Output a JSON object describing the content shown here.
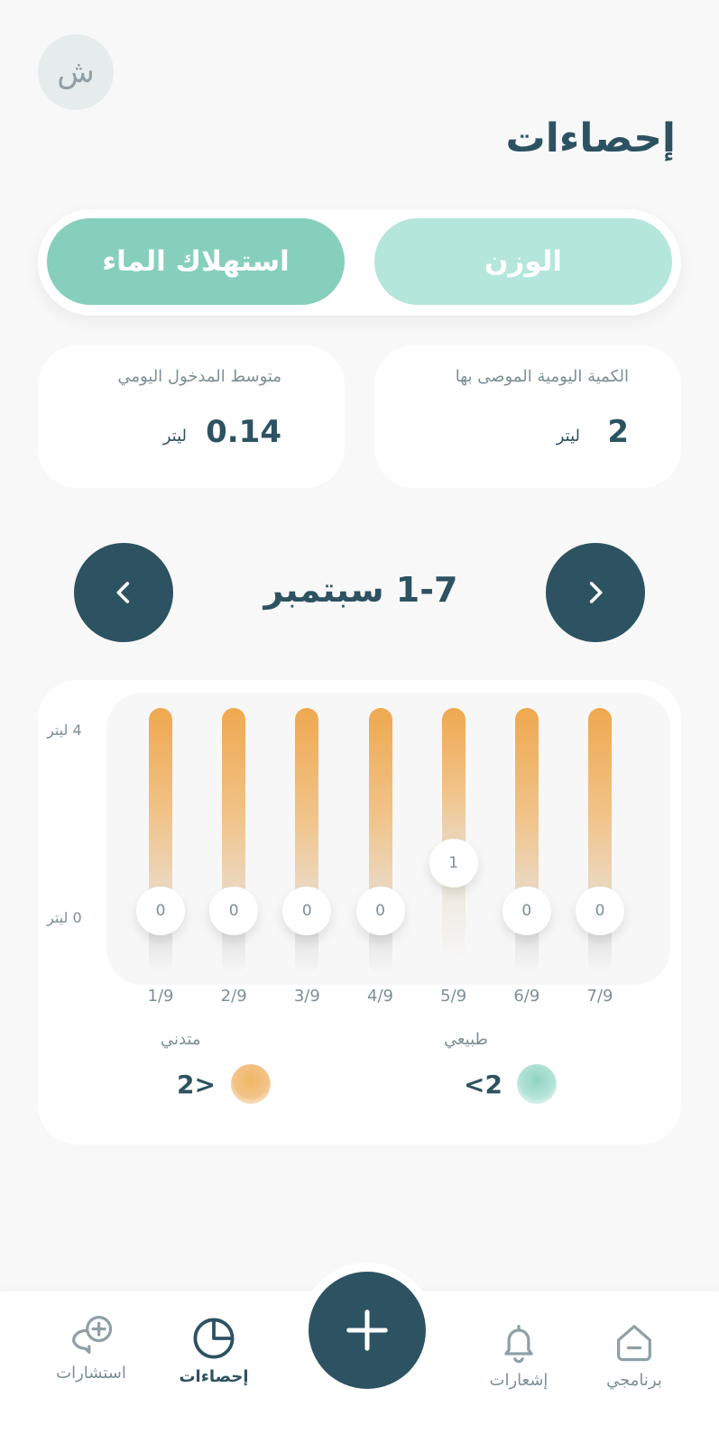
{
  "header": {
    "avatar_initial": "ش",
    "title": "إحصاءات"
  },
  "tabs": [
    {
      "label": "الوزن",
      "active": false
    },
    {
      "label": "استهلاك الماء",
      "active": true
    }
  ],
  "stats": {
    "average": {
      "label": "متوسط المدخول اليومي",
      "value": "0.14",
      "unit": "ليتر"
    },
    "recommended": {
      "label": "الكمية اليومية الموصى بها",
      "value": "2",
      "unit": "ليتر"
    }
  },
  "week": {
    "label": "1-7 سبتمبر"
  },
  "chart_data": {
    "type": "bar",
    "y_ticks": [
      "4 ليتر",
      "0 ليتر"
    ],
    "ylim": [
      0,
      4
    ],
    "categories": [
      "1/9",
      "2/9",
      "3/9",
      "4/9",
      "5/9",
      "6/9",
      "7/9"
    ],
    "values": [
      0,
      0,
      0,
      0,
      1,
      0,
      0
    ],
    "value_labels": [
      "0",
      "0",
      "0",
      "0",
      "1",
      "0",
      "0"
    ]
  },
  "legend": {
    "low": {
      "title": "متدني",
      "value": "2>",
      "color": "#f0b765"
    },
    "normal": {
      "title": "طبيعي",
      "value": "<2",
      "color": "#8fd4c2"
    }
  },
  "colors": {
    "primary": "#2d5262",
    "accent_green": "#86cfbc",
    "accent_orange": "#efa84f"
  },
  "bottom_nav": {
    "program": "برنامجي",
    "notifications": "إشعارات",
    "statistics": "إحصاءات",
    "consultations": "استشارات"
  }
}
